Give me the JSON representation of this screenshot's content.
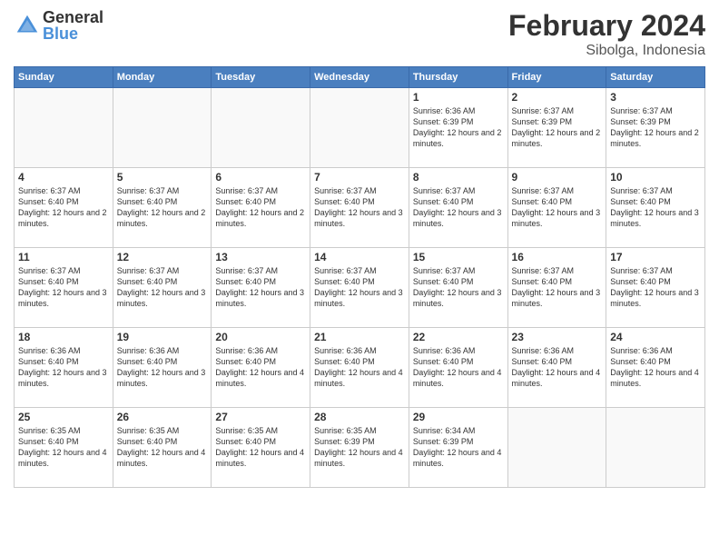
{
  "logo": {
    "general": "General",
    "blue": "Blue"
  },
  "title": {
    "month": "February 2024",
    "location": "Sibolga, Indonesia"
  },
  "days_of_week": [
    "Sunday",
    "Monday",
    "Tuesday",
    "Wednesday",
    "Thursday",
    "Friday",
    "Saturday"
  ],
  "weeks": [
    [
      {
        "day": "",
        "info": ""
      },
      {
        "day": "",
        "info": ""
      },
      {
        "day": "",
        "info": ""
      },
      {
        "day": "",
        "info": ""
      },
      {
        "day": "1",
        "info": "Sunrise: 6:36 AM\nSunset: 6:39 PM\nDaylight: 12 hours\nand 2 minutes."
      },
      {
        "day": "2",
        "info": "Sunrise: 6:37 AM\nSunset: 6:39 PM\nDaylight: 12 hours\nand 2 minutes."
      },
      {
        "day": "3",
        "info": "Sunrise: 6:37 AM\nSunset: 6:39 PM\nDaylight: 12 hours\nand 2 minutes."
      }
    ],
    [
      {
        "day": "4",
        "info": "Sunrise: 6:37 AM\nSunset: 6:40 PM\nDaylight: 12 hours\nand 2 minutes."
      },
      {
        "day": "5",
        "info": "Sunrise: 6:37 AM\nSunset: 6:40 PM\nDaylight: 12 hours\nand 2 minutes."
      },
      {
        "day": "6",
        "info": "Sunrise: 6:37 AM\nSunset: 6:40 PM\nDaylight: 12 hours\nand 2 minutes."
      },
      {
        "day": "7",
        "info": "Sunrise: 6:37 AM\nSunset: 6:40 PM\nDaylight: 12 hours\nand 3 minutes."
      },
      {
        "day": "8",
        "info": "Sunrise: 6:37 AM\nSunset: 6:40 PM\nDaylight: 12 hours\nand 3 minutes."
      },
      {
        "day": "9",
        "info": "Sunrise: 6:37 AM\nSunset: 6:40 PM\nDaylight: 12 hours\nand 3 minutes."
      },
      {
        "day": "10",
        "info": "Sunrise: 6:37 AM\nSunset: 6:40 PM\nDaylight: 12 hours\nand 3 minutes."
      }
    ],
    [
      {
        "day": "11",
        "info": "Sunrise: 6:37 AM\nSunset: 6:40 PM\nDaylight: 12 hours\nand 3 minutes."
      },
      {
        "day": "12",
        "info": "Sunrise: 6:37 AM\nSunset: 6:40 PM\nDaylight: 12 hours\nand 3 minutes."
      },
      {
        "day": "13",
        "info": "Sunrise: 6:37 AM\nSunset: 6:40 PM\nDaylight: 12 hours\nand 3 minutes."
      },
      {
        "day": "14",
        "info": "Sunrise: 6:37 AM\nSunset: 6:40 PM\nDaylight: 12 hours\nand 3 minutes."
      },
      {
        "day": "15",
        "info": "Sunrise: 6:37 AM\nSunset: 6:40 PM\nDaylight: 12 hours\nand 3 minutes."
      },
      {
        "day": "16",
        "info": "Sunrise: 6:37 AM\nSunset: 6:40 PM\nDaylight: 12 hours\nand 3 minutes."
      },
      {
        "day": "17",
        "info": "Sunrise: 6:37 AM\nSunset: 6:40 PM\nDaylight: 12 hours\nand 3 minutes."
      }
    ],
    [
      {
        "day": "18",
        "info": "Sunrise: 6:36 AM\nSunset: 6:40 PM\nDaylight: 12 hours\nand 3 minutes."
      },
      {
        "day": "19",
        "info": "Sunrise: 6:36 AM\nSunset: 6:40 PM\nDaylight: 12 hours\nand 3 minutes."
      },
      {
        "day": "20",
        "info": "Sunrise: 6:36 AM\nSunset: 6:40 PM\nDaylight: 12 hours\nand 4 minutes."
      },
      {
        "day": "21",
        "info": "Sunrise: 6:36 AM\nSunset: 6:40 PM\nDaylight: 12 hours\nand 4 minutes."
      },
      {
        "day": "22",
        "info": "Sunrise: 6:36 AM\nSunset: 6:40 PM\nDaylight: 12 hours\nand 4 minutes."
      },
      {
        "day": "23",
        "info": "Sunrise: 6:36 AM\nSunset: 6:40 PM\nDaylight: 12 hours\nand 4 minutes."
      },
      {
        "day": "24",
        "info": "Sunrise: 6:36 AM\nSunset: 6:40 PM\nDaylight: 12 hours\nand 4 minutes."
      }
    ],
    [
      {
        "day": "25",
        "info": "Sunrise: 6:35 AM\nSunset: 6:40 PM\nDaylight: 12 hours\nand 4 minutes."
      },
      {
        "day": "26",
        "info": "Sunrise: 6:35 AM\nSunset: 6:40 PM\nDaylight: 12 hours\nand 4 minutes."
      },
      {
        "day": "27",
        "info": "Sunrise: 6:35 AM\nSunset: 6:40 PM\nDaylight: 12 hours\nand 4 minutes."
      },
      {
        "day": "28",
        "info": "Sunrise: 6:35 AM\nSunset: 6:39 PM\nDaylight: 12 hours\nand 4 minutes."
      },
      {
        "day": "29",
        "info": "Sunrise: 6:34 AM\nSunset: 6:39 PM\nDaylight: 12 hours\nand 4 minutes."
      },
      {
        "day": "",
        "info": ""
      },
      {
        "day": "",
        "info": ""
      }
    ]
  ]
}
